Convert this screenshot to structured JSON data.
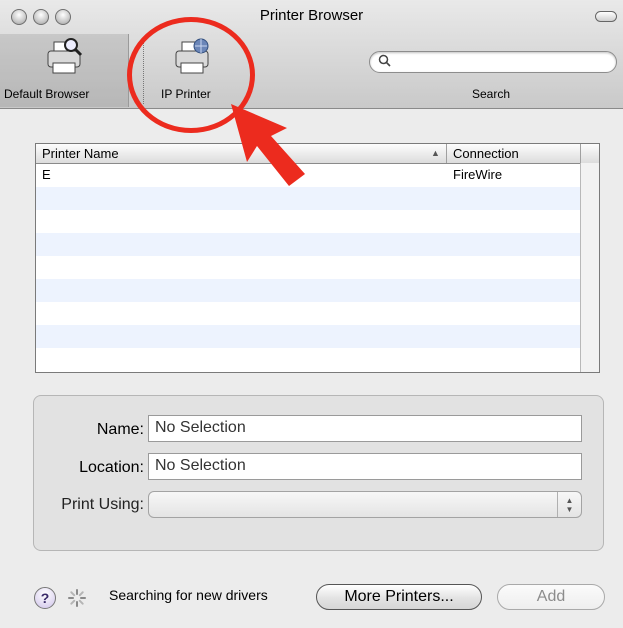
{
  "window": {
    "title": "Printer Browser"
  },
  "toolbar": {
    "default_browser_label": "Default Browser",
    "ip_printer_label": "IP Printer",
    "search_label": "Search",
    "search_placeholder": ""
  },
  "printer_table": {
    "columns": [
      "Printer Name",
      "Connection"
    ],
    "sort_indicator": "▲",
    "rows": [
      {
        "name": "E",
        "connection": "FireWire"
      }
    ]
  },
  "form": {
    "name_label": "Name:",
    "name_value": "No Selection",
    "location_label": "Location:",
    "location_value": "No Selection",
    "print_using_label": "Print Using:",
    "print_using_value": ""
  },
  "footer": {
    "help_label": "?",
    "status_text": "Searching for new drivers",
    "more_printers_label": "More Printers...",
    "add_label": "Add"
  },
  "annotation_color": "#ec2b1e"
}
